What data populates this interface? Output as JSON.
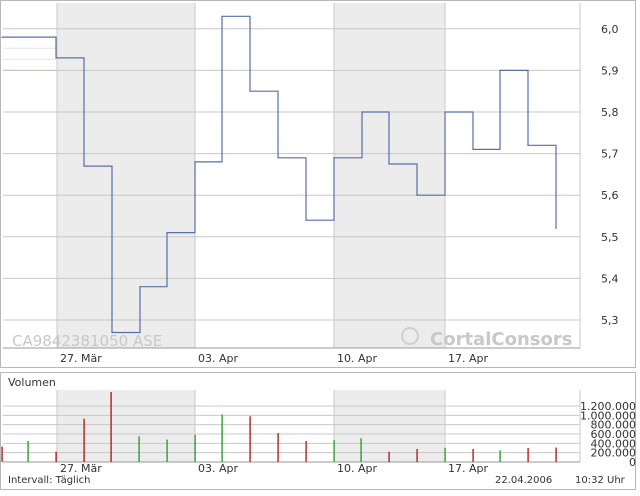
{
  "chart_data": {
    "price": {
      "type": "line",
      "step": true,
      "y_ticks": [
        "6,0",
        "5,9",
        "5,8",
        "5,7",
        "5,6",
        "5,5",
        "5,4",
        "5,3"
      ],
      "y_tick_values": [
        6.0,
        5.9,
        5.8,
        5.7,
        5.6,
        5.5,
        5.4,
        5.3
      ],
      "ylim": [
        5.27,
        6.03
      ],
      "x_ticks": [
        "27. Mär",
        "03. Apr",
        "10. Apr",
        "17. Apr"
      ],
      "x": [
        "2006-03-23",
        "2006-03-24",
        "2006-03-27",
        "2006-03-28",
        "2006-03-29",
        "2006-03-30",
        "2006-03-31",
        "2006-04-03",
        "2006-04-04",
        "2006-04-05",
        "2006-04-06",
        "2006-04-07",
        "2006-04-10",
        "2006-04-11",
        "2006-04-12",
        "2006-04-13",
        "2006-04-17",
        "2006-04-18",
        "2006-04-19",
        "2006-04-20",
        "2006-04-21"
      ],
      "values": [
        5.98,
        5.93,
        5.67,
        5.27,
        5.38,
        5.51,
        5.68,
        6.03,
        5.85,
        5.69,
        5.54,
        5.69,
        5.8,
        5.675,
        5.6,
        5.8,
        5.71,
        5.9,
        5.72,
        5.52
      ],
      "prev_close_line": 5.98,
      "grid": true,
      "watermark_left": "CA9842381050    ASE",
      "watermark_right": "CortalConsors",
      "colors": {
        "line": "#5a6fa6",
        "shade": "#ececec",
        "grid": "#c8c8c8",
        "ref": "#d28080"
      }
    },
    "volume": {
      "type": "bar",
      "title": "Volumen",
      "y_ticks": [
        "1.200.000",
        "1.000.000",
        "800.000",
        "600.000",
        "400.000",
        "200.000",
        "0"
      ],
      "y_tick_values": [
        1200000,
        1000000,
        800000,
        600000,
        400000,
        200000,
        0
      ],
      "ylim": [
        0,
        1200000
      ],
      "x_ticks": [
        "27. Mär",
        "03. Apr",
        "10. Apr",
        "17. Apr"
      ],
      "values": [
        330000,
        450000,
        220000,
        930000,
        1500000,
        550000,
        480000,
        580000,
        1020000,
        980000,
        620000,
        450000,
        470000,
        510000,
        220000,
        280000,
        300000,
        280000,
        250000,
        300000,
        310000
      ],
      "directions": [
        "down",
        "up",
        "down",
        "down",
        "down",
        "up",
        "up",
        "up",
        "up",
        "down",
        "down",
        "down",
        "up",
        "up",
        "down",
        "down",
        "up",
        "down",
        "up",
        "down",
        "down"
      ],
      "colors": {
        "up": "#2aa02a",
        "down": "#b02020"
      }
    }
  },
  "footer": {
    "interval": "Intervall: Täglich",
    "date": "22.04.2006",
    "time": "10:32 Uhr"
  }
}
